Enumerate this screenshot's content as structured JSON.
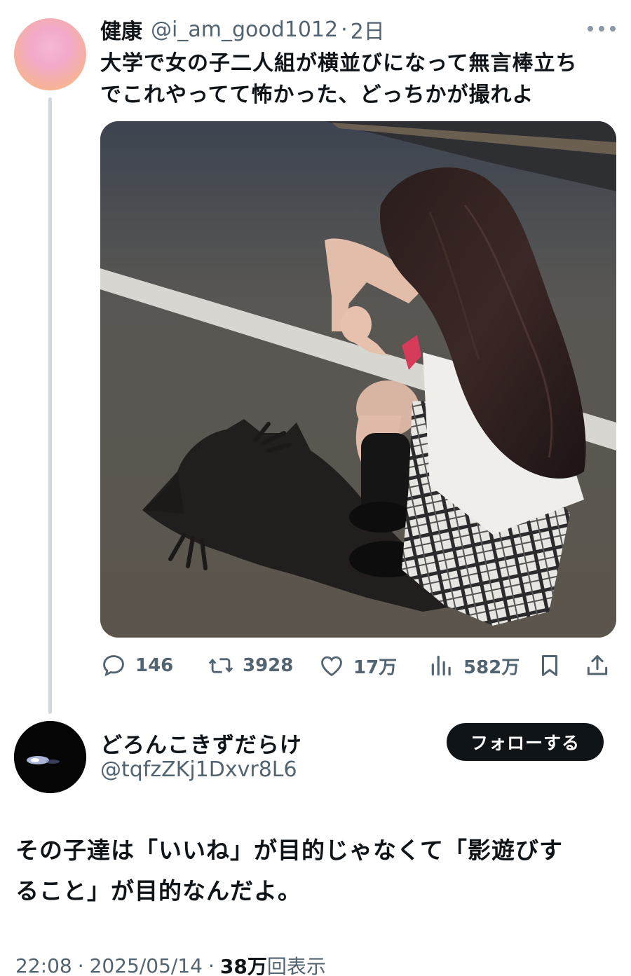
{
  "tweet": {
    "author_name": "健康",
    "author_handle": "@i_am_good1012",
    "separator": "·",
    "time": "2日",
    "text_line1": "大学で女の子二人組が横並びになって無言棒立ち",
    "text_line2": "でこれやってて怖かった、どっちかが撮れよ",
    "stats": {
      "replies": "146",
      "retweets": "3928",
      "likes": "17万",
      "views": "582万"
    }
  },
  "reply": {
    "author_name": "どろんこきずだらけ",
    "author_handle": "@tqfzZKj1Dxvr8L6",
    "follow_label": "フォローする",
    "text_line1": "その子達は「いいね」が目的じゃなくて「影遊びす",
    "text_line2": "ること」が目的なんだよ。",
    "time": "22:08",
    "date": "2025/05/14",
    "separator": "·",
    "views_count": "38万",
    "views_label": "回表示"
  },
  "icons": {
    "reply": "reply-icon",
    "retweet": "retweet-icon",
    "like": "heart-icon",
    "views": "views-chart-icon",
    "bookmark": "bookmark-icon",
    "share": "share-icon",
    "more": "more-dots-icon"
  },
  "colors": {
    "text_primary": "#0f1419",
    "text_secondary": "#536471",
    "follow_button": "#0f1419",
    "thread_line": "#cfd9de"
  }
}
